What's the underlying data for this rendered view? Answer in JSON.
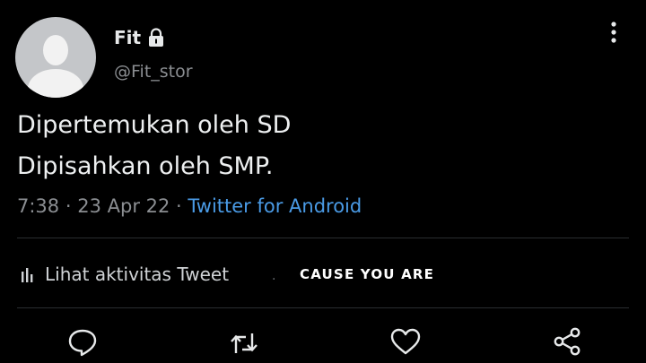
{
  "tweet": {
    "author": {
      "name": "Fit",
      "handle": "@Fit_stor",
      "protected_icon": "lock-icon"
    },
    "text_lines": [
      "Dipertemukan oleh SD",
      "Dipisahkan oleh SMP."
    ],
    "time": "7:38",
    "separator": "·",
    "date": "23 Apr 22",
    "source": "Twitter for Android",
    "activity_label": "Lihat aktivitas Tweet",
    "more_icon": "more-vertical-icon"
  },
  "overlay_caption": "CAUSE YOU ARE",
  "actions": {
    "reply_icon": "reply-icon",
    "retweet_icon": "retweet-icon",
    "like_icon": "heart-icon",
    "share_icon": "share-icon"
  },
  "colors": {
    "background": "#000000",
    "text": "#e7e9ea",
    "muted": "#8b8e92",
    "link": "#4a9be6"
  }
}
